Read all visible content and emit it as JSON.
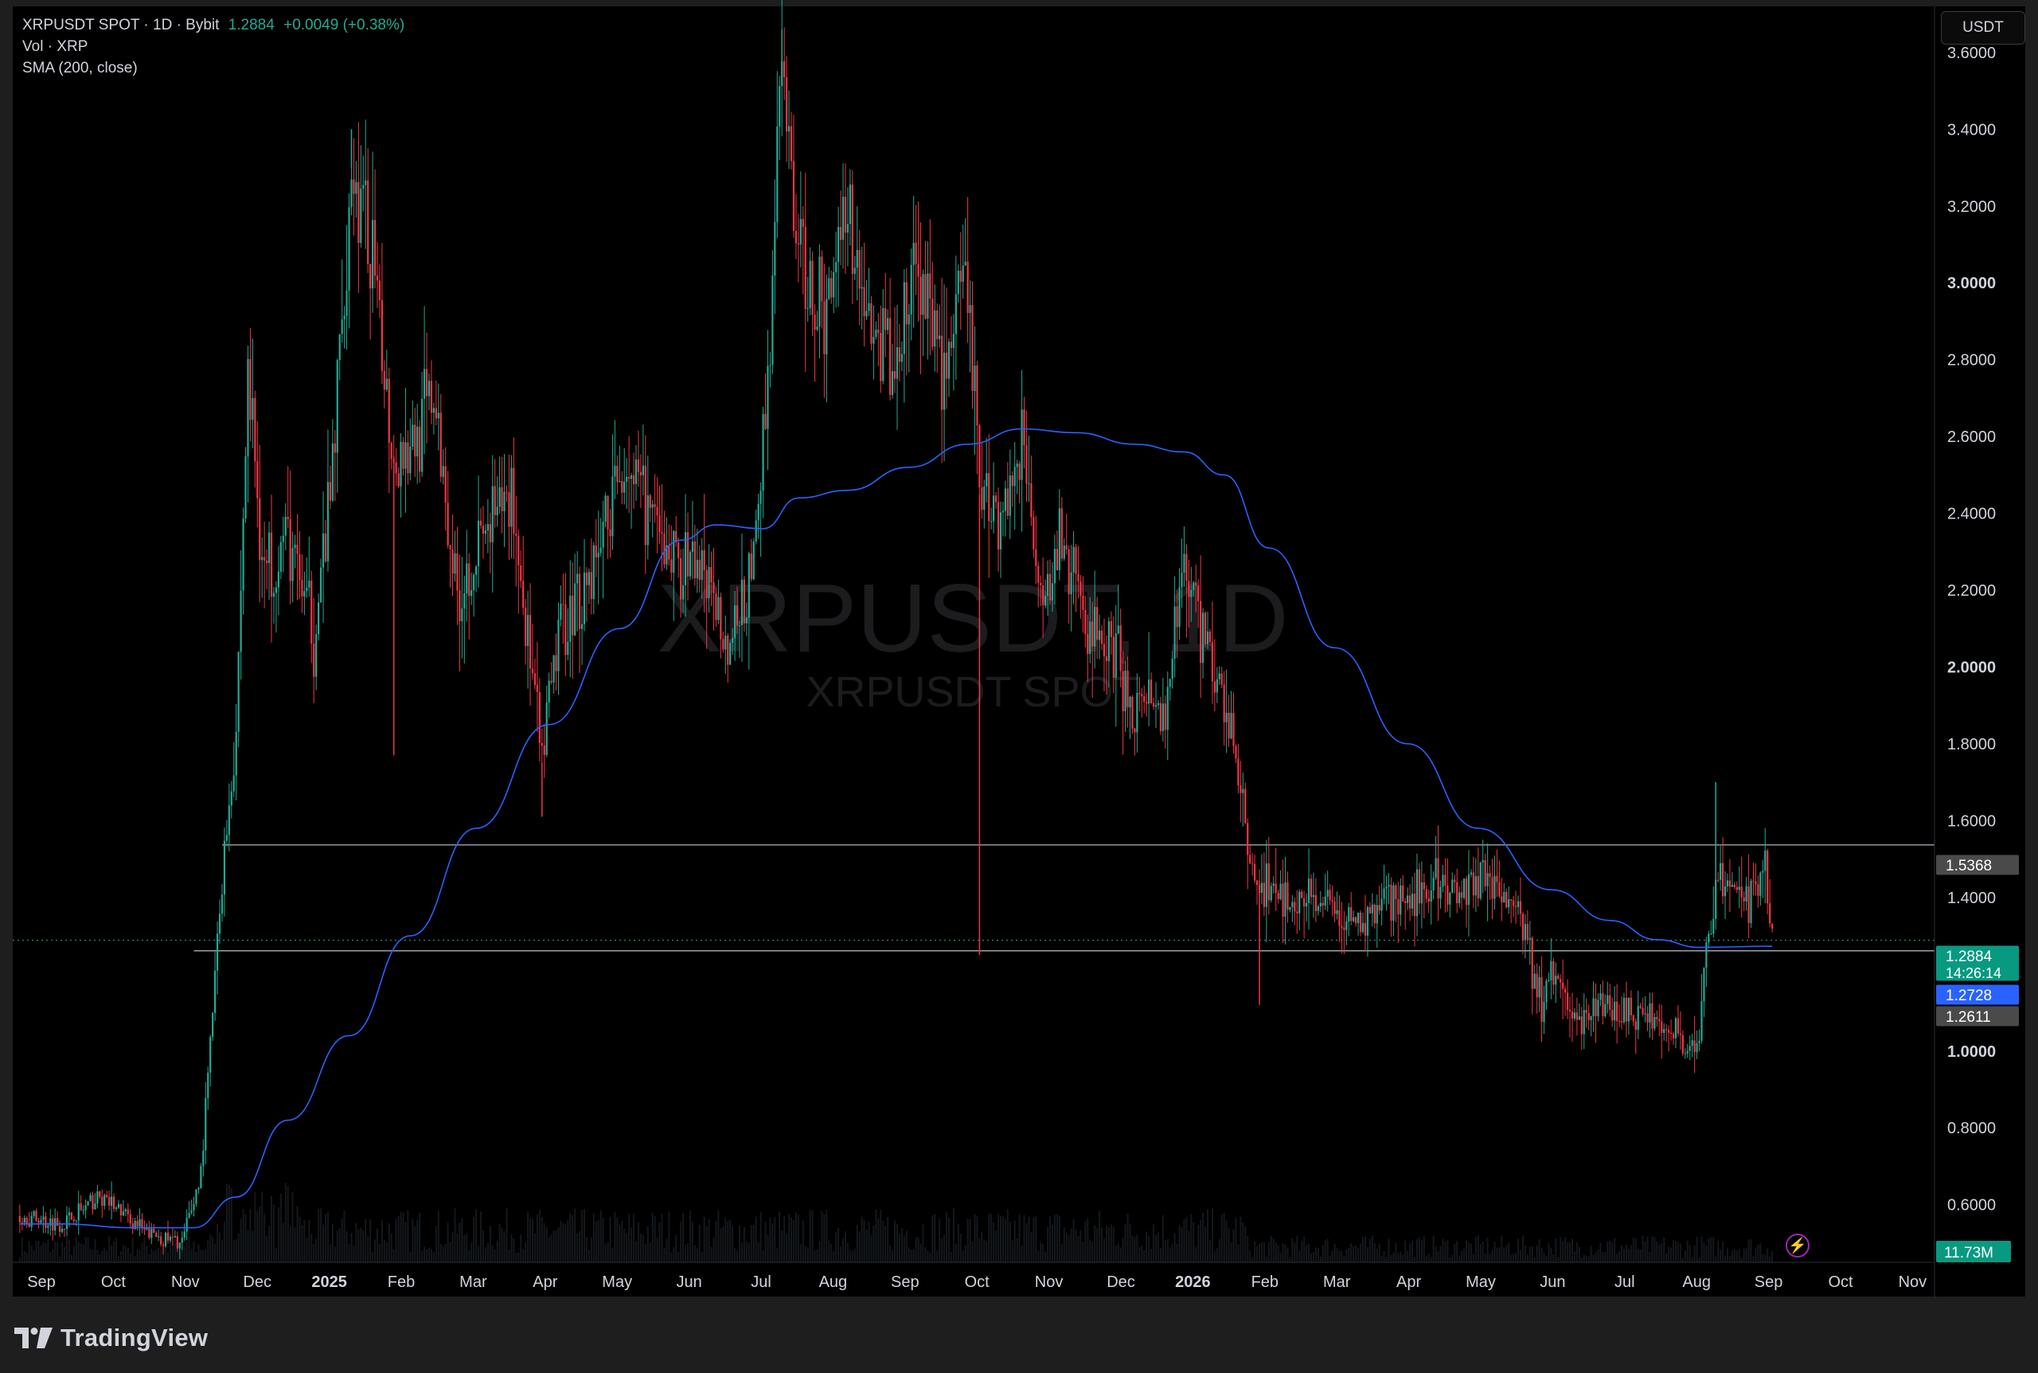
{
  "legend": {
    "symbol": "XRPUSDT SPOT · 1D · Bybit",
    "last_price": "1.2884",
    "change": "+0.0049 (+0.38%)",
    "volume_label": "Vol · XRP",
    "sma_label": "SMA (200, close)"
  },
  "currency_button": "USDT",
  "watermark": {
    "main": "XRPUSDT, 1D",
    "sub": "XRPUSDT SPOT"
  },
  "brand": "TradingView",
  "colors": {
    "background": "#000000",
    "up_candle": "#22ab94",
    "down_candle": "#f23645",
    "sma_line": "#2962ff",
    "level_line": "#787b86",
    "volume_badge": "#089981"
  },
  "chart_data": {
    "type": "candlestick",
    "symbol": "XRPUSDT SPOT",
    "timeframe": "1D",
    "exchange": "Bybit",
    "ylim": [
      0.45,
      3.72
    ],
    "y_ticks": [
      "3.6000",
      "3.4000",
      "3.2000",
      "3.0000",
      "2.8000",
      "2.6000",
      "2.4000",
      "2.2000",
      "2.0000",
      "1.8000",
      "1.6000",
      "1.4000",
      "1.2000",
      "1.0000",
      "0.8000",
      "0.6000"
    ],
    "y_tick_values": [
      3.6,
      3.4,
      3.2,
      3.0,
      2.8,
      2.6,
      2.4,
      2.2,
      2.0,
      1.8,
      1.6,
      1.4,
      1.2,
      1.0,
      0.8,
      0.6
    ],
    "bold_ticks": [
      "3.0000",
      "2.0000",
      "1.0000"
    ],
    "x_labels": [
      "Sep",
      "Oct",
      "Nov",
      "Dec",
      "2025",
      "Feb",
      "Mar",
      "Apr",
      "May",
      "Jun",
      "Jul",
      "Aug",
      "Sep",
      "Oct",
      "Nov",
      "Dec",
      "2026",
      "Feb",
      "Mar",
      "Apr",
      "May",
      "Jun",
      "Jul",
      "Aug",
      "Sep",
      "Oct",
      "Nov"
    ],
    "bold_x_labels": [
      "2025",
      "2026"
    ],
    "price_path": [
      [
        "2024-08-28",
        0.57
      ],
      [
        "2024-09-15",
        0.55
      ],
      [
        "2024-10-02",
        0.62
      ],
      [
        "2024-10-20",
        0.53
      ],
      [
        "2024-11-05",
        0.5
      ],
      [
        "2024-11-13",
        0.68
      ],
      [
        "2024-11-18",
        1.1
      ],
      [
        "2024-11-22",
        1.45
      ],
      [
        "2024-11-28",
        1.85
      ],
      [
        "2024-12-03",
        2.75
      ],
      [
        "2024-12-10",
        2.25
      ],
      [
        "2024-12-20",
        2.35
      ],
      [
        "2024-12-31",
        2.08
      ],
      [
        "2025-01-07",
        2.42
      ],
      [
        "2025-01-16",
        3.3
      ],
      [
        "2025-01-25",
        3.05
      ],
      [
        "2025-02-03",
        2.55
      ],
      [
        "2025-02-12",
        2.6
      ],
      [
        "2025-02-20",
        2.7
      ],
      [
        "2025-03-02",
        2.2
      ],
      [
        "2025-03-10",
        2.3
      ],
      [
        "2025-03-25",
        2.45
      ],
      [
        "2025-04-07",
        1.75
      ],
      [
        "2025-04-14",
        2.1
      ],
      [
        "2025-04-28",
        2.25
      ],
      [
        "2025-05-13",
        2.55
      ],
      [
        "2025-05-28",
        2.3
      ],
      [
        "2025-06-15",
        2.25
      ],
      [
        "2025-06-25",
        2.05
      ],
      [
        "2025-07-05",
        2.2
      ],
      [
        "2025-07-13",
        2.85
      ],
      [
        "2025-07-18",
        3.55
      ],
      [
        "2025-07-25",
        3.1
      ],
      [
        "2025-08-05",
        2.9
      ],
      [
        "2025-08-14",
        3.25
      ],
      [
        "2025-08-25",
        2.85
      ],
      [
        "2025-09-05",
        2.8
      ],
      [
        "2025-09-13",
        3.05
      ],
      [
        "2025-09-25",
        2.78
      ],
      [
        "2025-10-05",
        3.0
      ],
      [
        "2025-10-10",
        2.45
      ],
      [
        "2025-10-20",
        2.4
      ],
      [
        "2025-10-28",
        2.6
      ],
      [
        "2025-11-04",
        2.25
      ],
      [
        "2025-11-15",
        2.3
      ],
      [
        "2025-11-25",
        2.1
      ],
      [
        "2025-12-05",
        2.05
      ],
      [
        "2025-12-15",
        1.9
      ],
      [
        "2025-12-28",
        1.85
      ],
      [
        "2026-01-05",
        2.3
      ],
      [
        "2026-01-15",
        2.05
      ],
      [
        "2026-01-25",
        1.85
      ],
      [
        "2026-02-01",
        1.5
      ],
      [
        "2026-02-08",
        1.42
      ],
      [
        "2026-02-20",
        1.4
      ],
      [
        "2026-03-05",
        1.38
      ],
      [
        "2026-03-20",
        1.33
      ],
      [
        "2026-04-05",
        1.4
      ],
      [
        "2026-04-20",
        1.45
      ],
      [
        "2026-05-05",
        1.42
      ],
      [
        "2026-05-15",
        1.45
      ],
      [
        "2026-05-28",
        1.35
      ],
      [
        "2026-06-06",
        1.12
      ],
      [
        "2026-06-12",
        1.22
      ],
      [
        "2026-06-20",
        1.08
      ],
      [
        "2026-07-01",
        1.12
      ],
      [
        "2026-07-15",
        1.1
      ],
      [
        "2026-07-30",
        1.06
      ],
      [
        "2026-08-12",
        1.0
      ],
      [
        "2026-08-15",
        1.25
      ],
      [
        "2026-08-20",
        1.48
      ],
      [
        "2026-08-25",
        1.42
      ],
      [
        "2026-09-02",
        1.4
      ],
      [
        "2026-09-09",
        1.45
      ],
      [
        "2026-09-12",
        1.2884
      ]
    ],
    "spikes": [
      {
        "date": "2025-10-10",
        "low": 1.25
      },
      {
        "date": "2026-02-06",
        "low": 1.12
      },
      {
        "date": "2026-08-19",
        "high": 1.7
      },
      {
        "date": "2025-07-18",
        "high": 3.66
      },
      {
        "date": "2025-01-16",
        "high": 3.4
      },
      {
        "date": "2025-04-07",
        "low": 1.61
      },
      {
        "date": "2025-02-03",
        "low": 1.77
      }
    ],
    "series": [
      {
        "name": "SMA (200, close)",
        "points": [
          [
            "2024-08-28",
            0.55
          ],
          [
            "2024-09-15",
            0.55
          ],
          [
            "2024-10-15",
            0.54
          ],
          [
            "2024-11-10",
            0.54
          ],
          [
            "2024-11-28",
            0.62
          ],
          [
            "2024-12-20",
            0.82
          ],
          [
            "2025-01-15",
            1.04
          ],
          [
            "2025-02-10",
            1.3
          ],
          [
            "2025-03-10",
            1.58
          ],
          [
            "2025-04-10",
            1.85
          ],
          [
            "2025-05-10",
            2.1
          ],
          [
            "2025-06-05",
            2.33
          ],
          [
            "2025-06-20",
            2.37
          ],
          [
            "2025-07-10",
            2.36
          ],
          [
            "2025-07-25",
            2.44
          ],
          [
            "2025-08-15",
            2.46
          ],
          [
            "2025-09-10",
            2.52
          ],
          [
            "2025-10-05",
            2.58
          ],
          [
            "2025-10-28",
            2.62
          ],
          [
            "2025-11-20",
            2.61
          ],
          [
            "2025-12-15",
            2.58
          ],
          [
            "2026-01-05",
            2.56
          ],
          [
            "2026-01-22",
            2.5
          ],
          [
            "2026-02-10",
            2.31
          ],
          [
            "2026-03-10",
            2.05
          ],
          [
            "2026-04-10",
            1.8
          ],
          [
            "2026-05-10",
            1.58
          ],
          [
            "2026-06-10",
            1.42
          ],
          [
            "2026-07-05",
            1.34
          ],
          [
            "2026-07-25",
            1.29
          ],
          [
            "2026-08-12",
            1.27
          ],
          [
            "2026-09-12",
            1.2728
          ]
        ]
      }
    ],
    "horizontal_levels": [
      {
        "value": 1.5368,
        "start": "2024-11-22"
      },
      {
        "value": 1.2611,
        "start": "2024-11-10"
      }
    ],
    "price_labels": [
      {
        "label": "1.5368",
        "value": 1.5368,
        "color": "#4a4a4a"
      },
      {
        "label": "1.2884",
        "value": 1.2884,
        "color": "#089981",
        "sub": "14:26:14"
      },
      {
        "label": "1.2728",
        "value": 1.2728,
        "color": "#2962ff"
      },
      {
        "label": "1.2611",
        "value": 1.2611,
        "color": "#4a4a4a"
      }
    ],
    "volume_label": "11.73M",
    "legend": "top-left",
    "grid": false
  }
}
